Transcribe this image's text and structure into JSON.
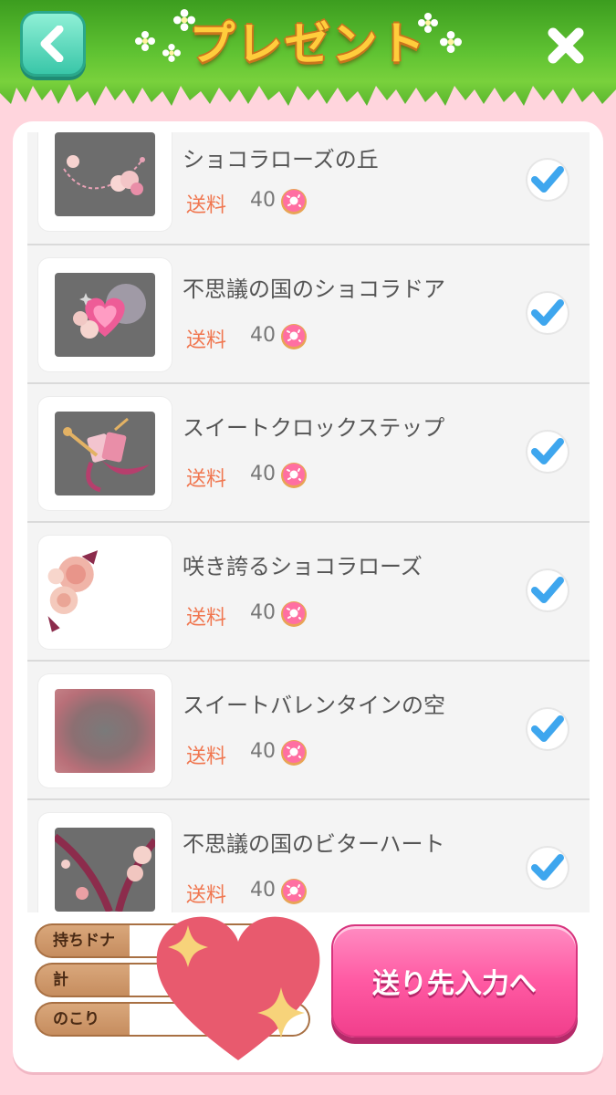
{
  "header": {
    "title": "プレゼント",
    "back_icon": "chevron-left-icon",
    "close_icon": "close-icon"
  },
  "items": [
    {
      "name": "ショコラローズの丘",
      "fee_label": "送料",
      "fee": "40",
      "checked": true
    },
    {
      "name": "不思議の国のショコラドア",
      "fee_label": "送料",
      "fee": "40",
      "checked": true
    },
    {
      "name": "スイートクロックステップ",
      "fee_label": "送料",
      "fee": "40",
      "checked": true
    },
    {
      "name": "咲き誇るショコラローズ",
      "fee_label": "送料",
      "fee": "40",
      "checked": true
    },
    {
      "name": "スイートバレンタインの空",
      "fee_label": "送料",
      "fee": "40",
      "checked": true
    },
    {
      "name": "不思議の国のビターハート",
      "fee_label": "送料",
      "fee": "40",
      "checked": true
    }
  ],
  "summary": {
    "owned_label": "持ちドナ",
    "total_label": "計",
    "remaining_label": "のこり"
  },
  "submit_label": "送り先入力へ",
  "colors": {
    "accent_pink": "#ff5aa3",
    "check_blue": "#3ea6ee",
    "fee_orange": "#f0764f",
    "header_green": "#5fc232"
  }
}
